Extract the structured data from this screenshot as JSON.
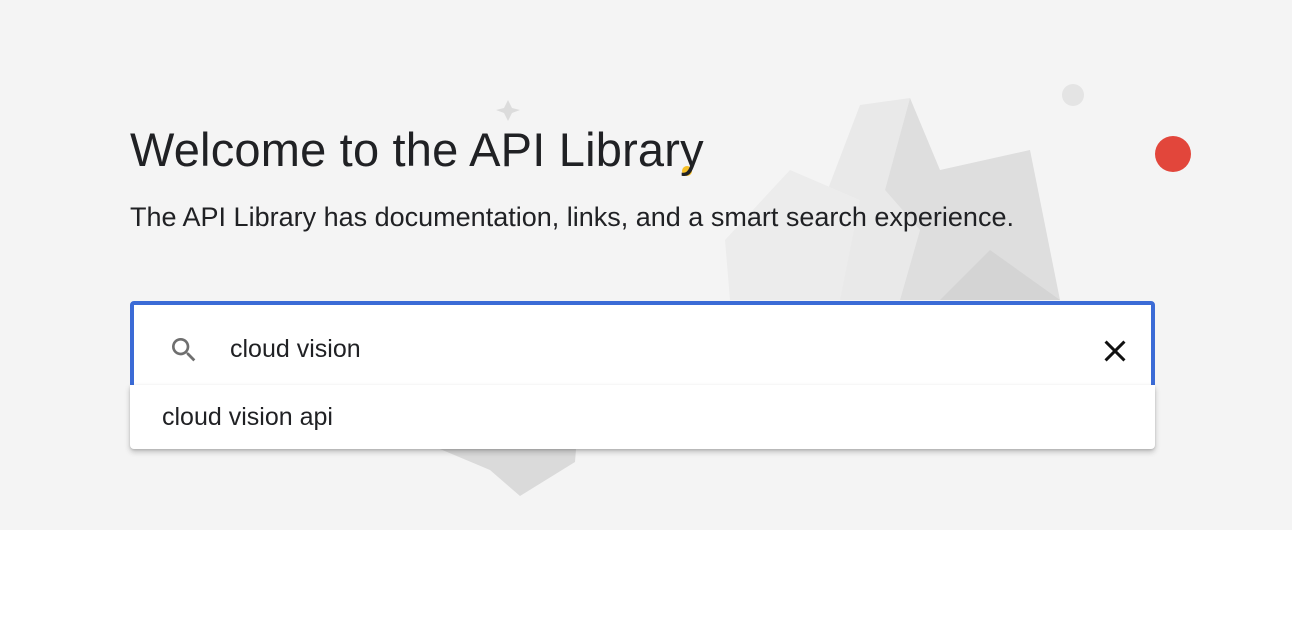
{
  "hero": {
    "title": "Welcome to the API Library",
    "subtitle": "The API Library has documentation, links, and a smart search experience."
  },
  "search": {
    "value": "cloud vision",
    "icon": "search-icon",
    "clear_icon": "close-icon",
    "accent_color": "#3b6bd6"
  },
  "suggestions": [
    {
      "label": "cloud vision api"
    }
  ],
  "colors": {
    "hero_background": "#f4f4f4",
    "decor_red": "#e2463b",
    "decor_yellow": "#f6bf26"
  }
}
